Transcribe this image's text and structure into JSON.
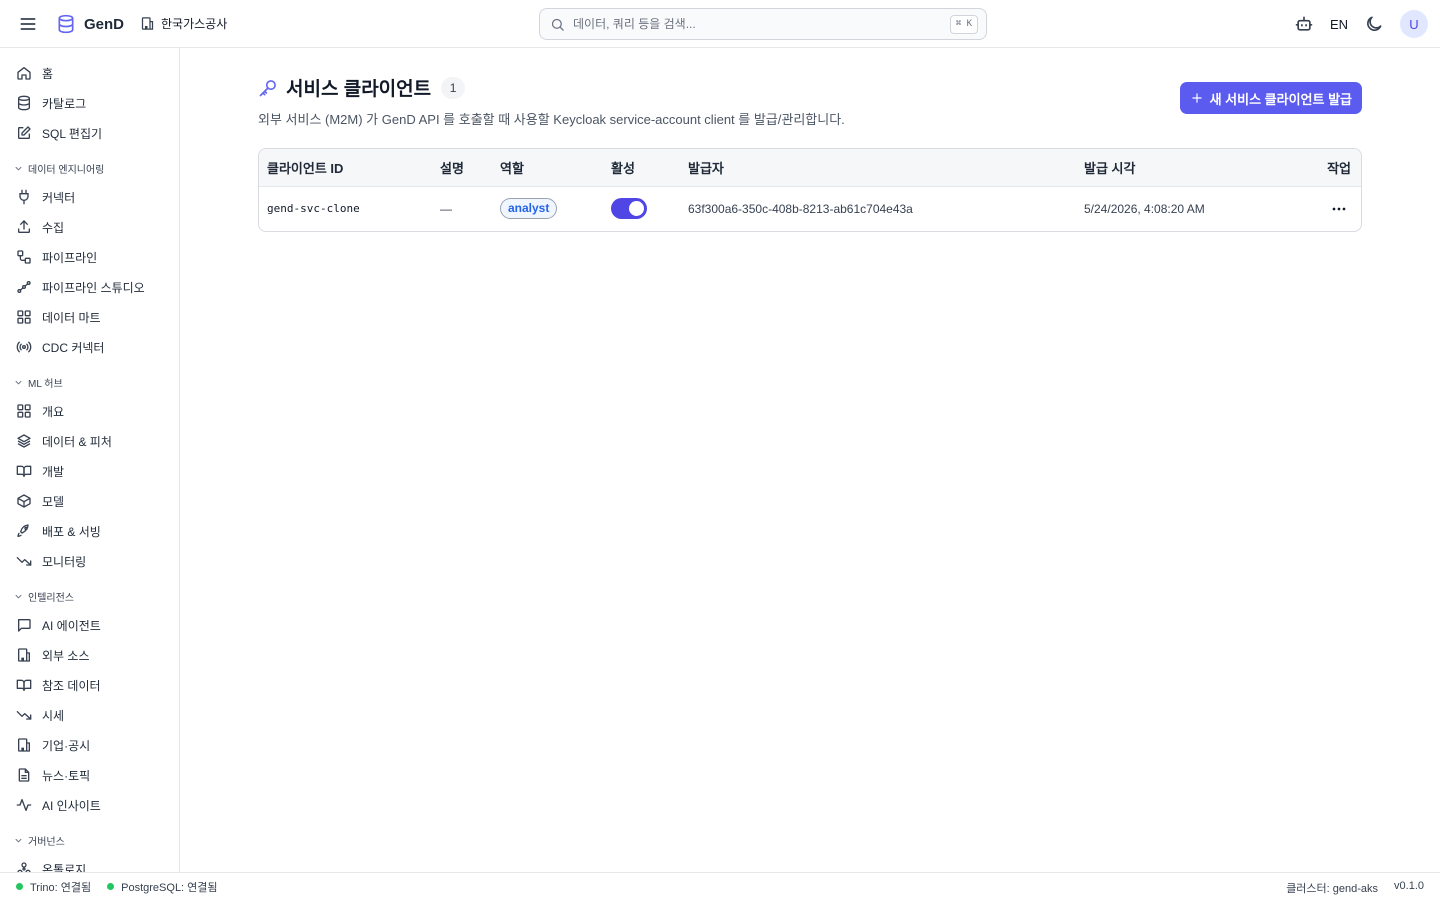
{
  "header": {
    "app_name": "GenD",
    "org_name": "한국가스공사",
    "search_placeholder": "데이터, 쿼리 등을 검색...",
    "shortcut": "⌘ K",
    "lang": "EN",
    "avatar_initial": "U"
  },
  "sidebar": {
    "top_items": [
      {
        "label": "홈",
        "icon": "home-icon"
      },
      {
        "label": "카탈로그",
        "icon": "database-icon"
      },
      {
        "label": "SQL 편집기",
        "icon": "edit-icon"
      }
    ],
    "sections": [
      {
        "title": "데이터 엔지니어링",
        "items": [
          {
            "label": "커넥터",
            "icon": "plug-icon"
          },
          {
            "label": "수집",
            "icon": "upload-icon"
          },
          {
            "label": "파이프라인",
            "icon": "workflow-icon"
          },
          {
            "label": "파이프라인 스튜디오",
            "icon": "flow-icon"
          },
          {
            "label": "데이터 마트",
            "icon": "grid-icon"
          },
          {
            "label": "CDC 커넥터",
            "icon": "radio-icon"
          }
        ]
      },
      {
        "title": "ML 허브",
        "items": [
          {
            "label": "개요",
            "icon": "grid-icon"
          },
          {
            "label": "데이터 & 피처",
            "icon": "layers-icon"
          },
          {
            "label": "개발",
            "icon": "book-icon"
          },
          {
            "label": "모델",
            "icon": "box-icon"
          },
          {
            "label": "배포 & 서빙",
            "icon": "rocket-icon"
          },
          {
            "label": "모니터링",
            "icon": "trend-down-icon"
          }
        ]
      },
      {
        "title": "인텔리전스",
        "items": [
          {
            "label": "AI 에이전트",
            "icon": "chat-icon"
          },
          {
            "label": "외부 소스",
            "icon": "building-icon"
          },
          {
            "label": "참조 데이터",
            "icon": "book-icon"
          },
          {
            "label": "시세",
            "icon": "trend-down-icon"
          },
          {
            "label": "기업·공시",
            "icon": "building-icon"
          },
          {
            "label": "뉴스·토픽",
            "icon": "file-text-icon"
          },
          {
            "label": "AI 인사이트",
            "icon": "activity-icon"
          }
        ]
      },
      {
        "title": "거버넌스",
        "items": [
          {
            "label": "온톨로지",
            "icon": "network-icon"
          }
        ]
      }
    ]
  },
  "page": {
    "title": "서비스 클라이언트",
    "count": "1",
    "subtitle": "외부 서비스 (M2M) 가 GenD API 를 호출할 때 사용할 Keycloak service-account client 를 발급/관리합니다.",
    "new_button_label": "새 서비스 클라이언트 발급"
  },
  "table": {
    "columns": [
      "클라이언트 ID",
      "설명",
      "역할",
      "활성",
      "발급자",
      "발급 시각",
      "작업"
    ],
    "rows": [
      {
        "client_id": "gend-svc-clone",
        "description": "—",
        "role": "analyst",
        "active": true,
        "issuer": "63f300a6-350c-408b-8213-ab61c704e43a",
        "issued_at": "5/24/2026, 4:08:20 AM"
      }
    ]
  },
  "status": {
    "trino": "Trino: 연결됨",
    "postgres": "PostgreSQL: 연결됨",
    "cluster": "클러스터: gend-aks",
    "version": "v0.1.0"
  },
  "colors": {
    "accent": "#5b5bf0",
    "status_ok": "#22c55e",
    "role_badge_text": "#2563eb"
  }
}
